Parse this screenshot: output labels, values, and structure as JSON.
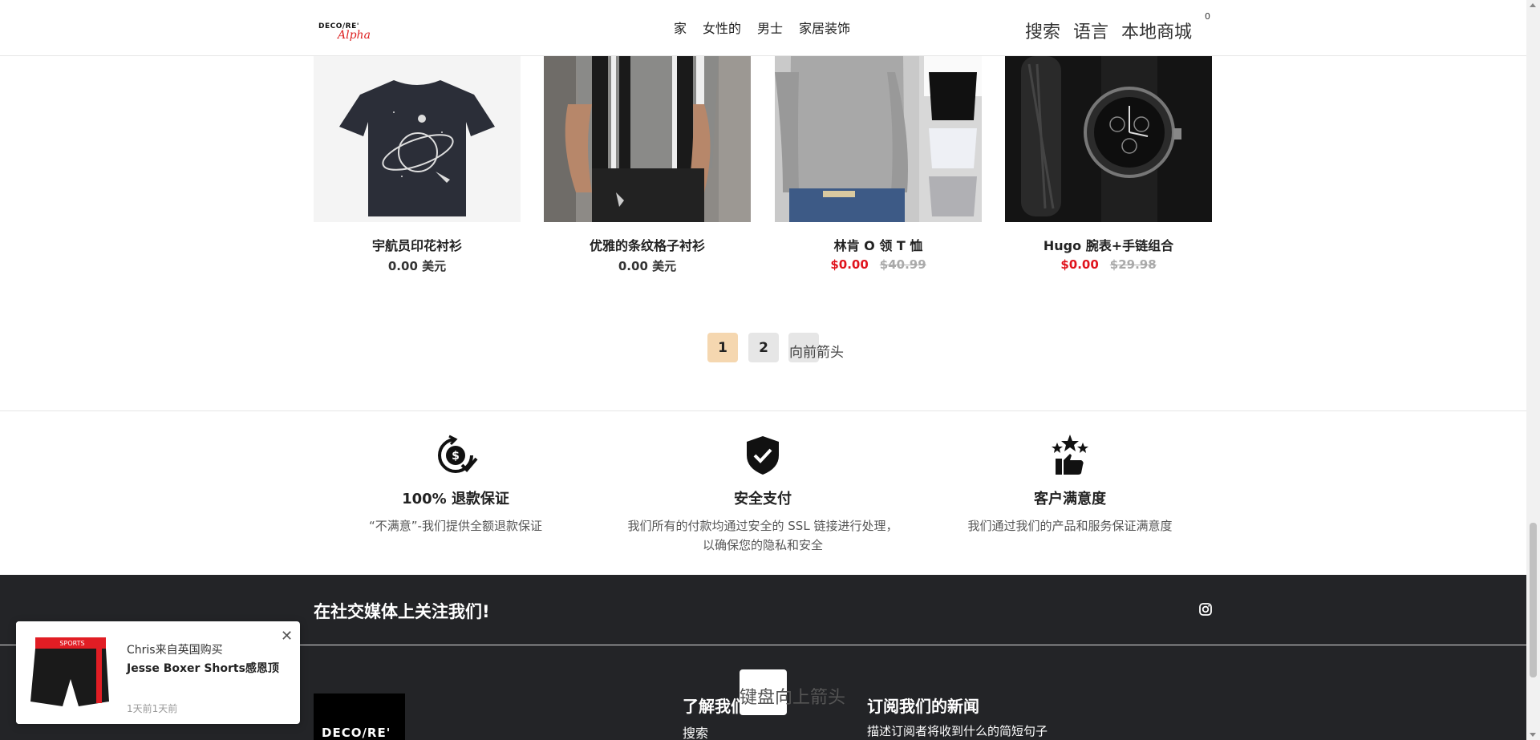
{
  "header": {
    "logo_text": "DECO/RE'",
    "logo_script": "Alpha",
    "nav": [
      "家",
      "女性的",
      "男士",
      "家居装饰"
    ],
    "search_label": "搜索",
    "language_label": "语言",
    "store_label": "本地商城",
    "cart_count": "0"
  },
  "products": [
    {
      "name": "宇航员印花衬衫",
      "price": "0.00 美元",
      "sale_price": "",
      "original_price": "",
      "image": "astronaut-tshirt-image"
    },
    {
      "name": "优雅的条纹格子衬衫",
      "price": "0.00 美元",
      "sale_price": "",
      "original_price": "",
      "image": "striped-shirt-image"
    },
    {
      "name": "林肯 O 领 T 恤",
      "price": "",
      "sale_price": "$0.00",
      "original_price": "$40.99",
      "image": "crew-neck-tee-image"
    },
    {
      "name": "Hugo 腕表+手链组合",
      "price": "",
      "sale_price": "$0.00",
      "original_price": "$29.98",
      "image": "watch-bracelet-image"
    }
  ],
  "pagination": {
    "pages": [
      "1",
      "2"
    ],
    "current": "1",
    "next_label": "向前箭头"
  },
  "features": [
    {
      "title": "100% 退款保证",
      "desc": "“不满意”-我们提供全额退款保证",
      "icon": "refund-icon"
    },
    {
      "title": "安全支付",
      "desc": "我们所有的付款均通过安全的 SSL 链接进行处理，以确保您的隐私和安全",
      "icon": "shield-check-icon"
    },
    {
      "title": "客户满意度",
      "desc": "我们通过我们的产品和服务保证满意度",
      "icon": "thumbs-up-stars-icon"
    }
  ],
  "footer": {
    "follow_label": "在社交媒体上关注我们!",
    "logo_text": "DECO/RE'",
    "about_title": "了解我们",
    "about_links": [
      "搜索"
    ],
    "newsletter_title": "订阅我们的新闻",
    "newsletter_desc": "描述订阅者将收到什么的简短句子"
  },
  "back_to_top": {
    "label": "键盘向上箭头"
  },
  "popup": {
    "buyer": "Chris来自英国购买",
    "product": "Jesse Boxer Shorts感恩顶",
    "time": "1天前1天前",
    "brand_text": "SPORTS"
  },
  "colors": {
    "accent_page": "#f5d7b0",
    "sale_red": "#e0131c",
    "footer_bg": "#232427"
  }
}
